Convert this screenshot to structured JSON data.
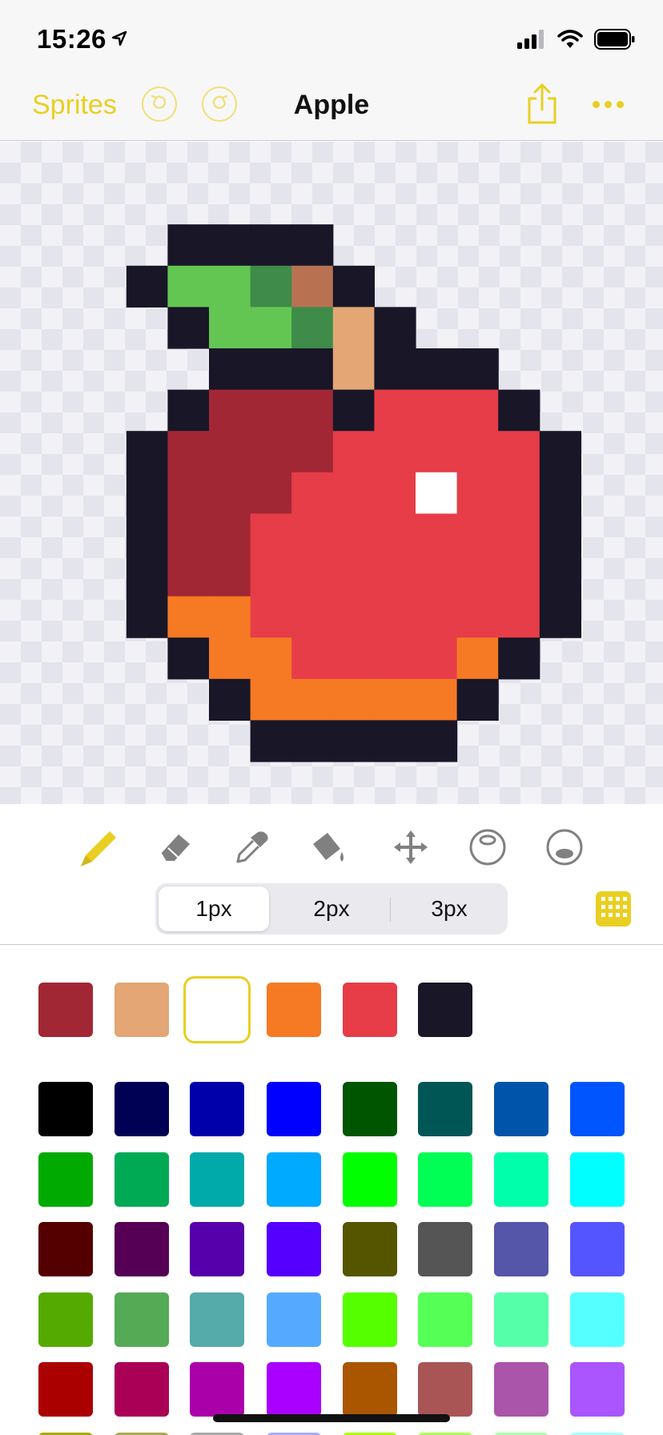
{
  "status_bar": {
    "time": "15:26",
    "icons": [
      "location-arrow-icon",
      "cellular-signal-icon",
      "wifi-icon",
      "battery-icon"
    ]
  },
  "nav": {
    "back_label": "Sprites",
    "title": "Apple",
    "icons": [
      "undo-icon",
      "redo-icon",
      "share-icon",
      "more-icon"
    ]
  },
  "colors": {
    "accent": "#e9cf22",
    "outline": "#181627",
    "leaf": "#63c652",
    "leaf_dark": "#3e8b4a",
    "stem": "#b87252",
    "stem_light": "#e3a674",
    "apple_dark": "#a22735",
    "apple": "#e63d48",
    "apple_base": "#f67924",
    "highlight": "#ffffff"
  },
  "sprite": {
    "legend": {
      "K": "#181627",
      "G": "#63c652",
      "D": "#3e8b4a",
      "B": "#b87252",
      "T": "#e3a674",
      "M": "#a22735",
      "R": "#e63d48",
      "O": "#f67924",
      "W": "#ffffff"
    },
    "rows": [
      "................",
      "................",
      "....KKKK........",
      "...KGGDBK.......",
      "....KGGDTK......",
      ".....KKKTKKK....",
      "....KMMMKRRRK...",
      "...KMMMMRRRRRK..",
      "...KMMMRRRWRRK..",
      "...KMMRRRRRRRK..",
      "...KMMRRRRRRRK..",
      "...KOORRRRRRRK..",
      "....KOORRRROK...",
      ".....KOOOOOK....",
      "......KKKKK.....",
      "................",
      "................",
      "................"
    ]
  },
  "tools": [
    {
      "name": "pencil-tool",
      "icon": "pencil-icon",
      "active": true
    },
    {
      "name": "eraser-tool",
      "icon": "eraser-icon",
      "active": false
    },
    {
      "name": "eyedropper-tool",
      "icon": "eyedropper-icon",
      "active": false
    },
    {
      "name": "fill-tool",
      "icon": "paint-bucket-icon",
      "active": false
    },
    {
      "name": "move-tool",
      "icon": "move-arrows-icon",
      "active": false
    },
    {
      "name": "ellipse-outline-tool",
      "icon": "ellipse-outline-icon",
      "active": false
    },
    {
      "name": "ellipse-fill-tool",
      "icon": "ellipse-fill-icon",
      "active": false
    }
  ],
  "brush_sizes": {
    "options": [
      "1px",
      "2px",
      "3px"
    ],
    "selected": "1px"
  },
  "recent_colors": [
    "#a22735",
    "#e3a674",
    "#ffffff",
    "#f67924",
    "#e63d48",
    "#181627"
  ],
  "selected_recent_index": 2,
  "palette": [
    [
      "#000000",
      "#000055",
      "#0000aa",
      "#0000ff",
      "#005500",
      "#005555",
      "#0055aa",
      "#0055ff"
    ],
    [
      "#00aa00",
      "#00aa55",
      "#00aaaa",
      "#00aaff",
      "#00ff00",
      "#00ff55",
      "#00ffaa",
      "#00ffff"
    ],
    [
      "#550000",
      "#550055",
      "#5500aa",
      "#5500ff",
      "#555500",
      "#555555",
      "#5555aa",
      "#5555ff"
    ],
    [
      "#55aa00",
      "#55aa55",
      "#55aaaa",
      "#55aaff",
      "#55ff00",
      "#55ff55",
      "#55ffaa",
      "#55ffff"
    ],
    [
      "#aa0000",
      "#aa0055",
      "#aa00aa",
      "#aa00ff",
      "#aa5500",
      "#aa5555",
      "#aa55aa",
      "#aa55ff"
    ],
    [
      "#aaaa00",
      "#aaaa55",
      "#aaaaaa",
      "#aaaaff",
      "#aaff00",
      "#aaff55",
      "#aaffaa",
      "#aaffff"
    ]
  ]
}
